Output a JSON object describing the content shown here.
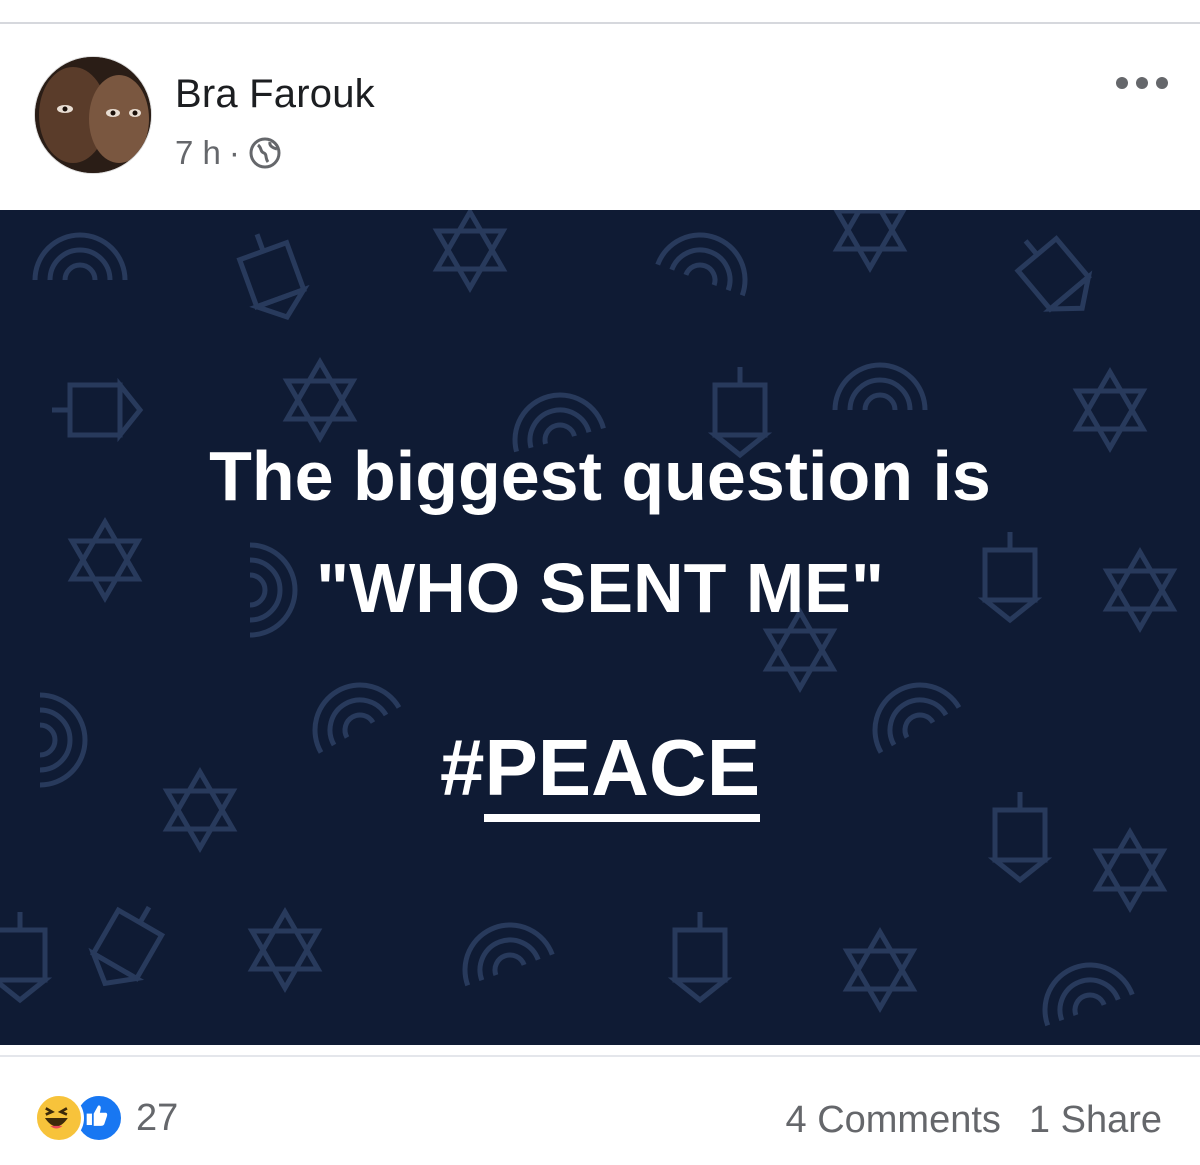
{
  "post": {
    "author": "Bra Farouk",
    "time": "7 h",
    "separator": "·",
    "privacy_icon": "globe-icon",
    "more_icon": "more-options-icon"
  },
  "image": {
    "background_color": "#0f1b34",
    "headline_line1": "The biggest question is",
    "headline_line2": "\"WHO SENT ME\"",
    "hashtag_symbol": "#",
    "hashtag_word": "PEACE"
  },
  "footer": {
    "reaction_icons": [
      "haha-icon",
      "like-icon"
    ],
    "reaction_count": "27",
    "comments": "4 Comments",
    "shares": "1 Share"
  },
  "colors": {
    "like_blue": "#1877f2",
    "haha_yellow": "#f7c33b",
    "text_secondary": "#65676b"
  }
}
